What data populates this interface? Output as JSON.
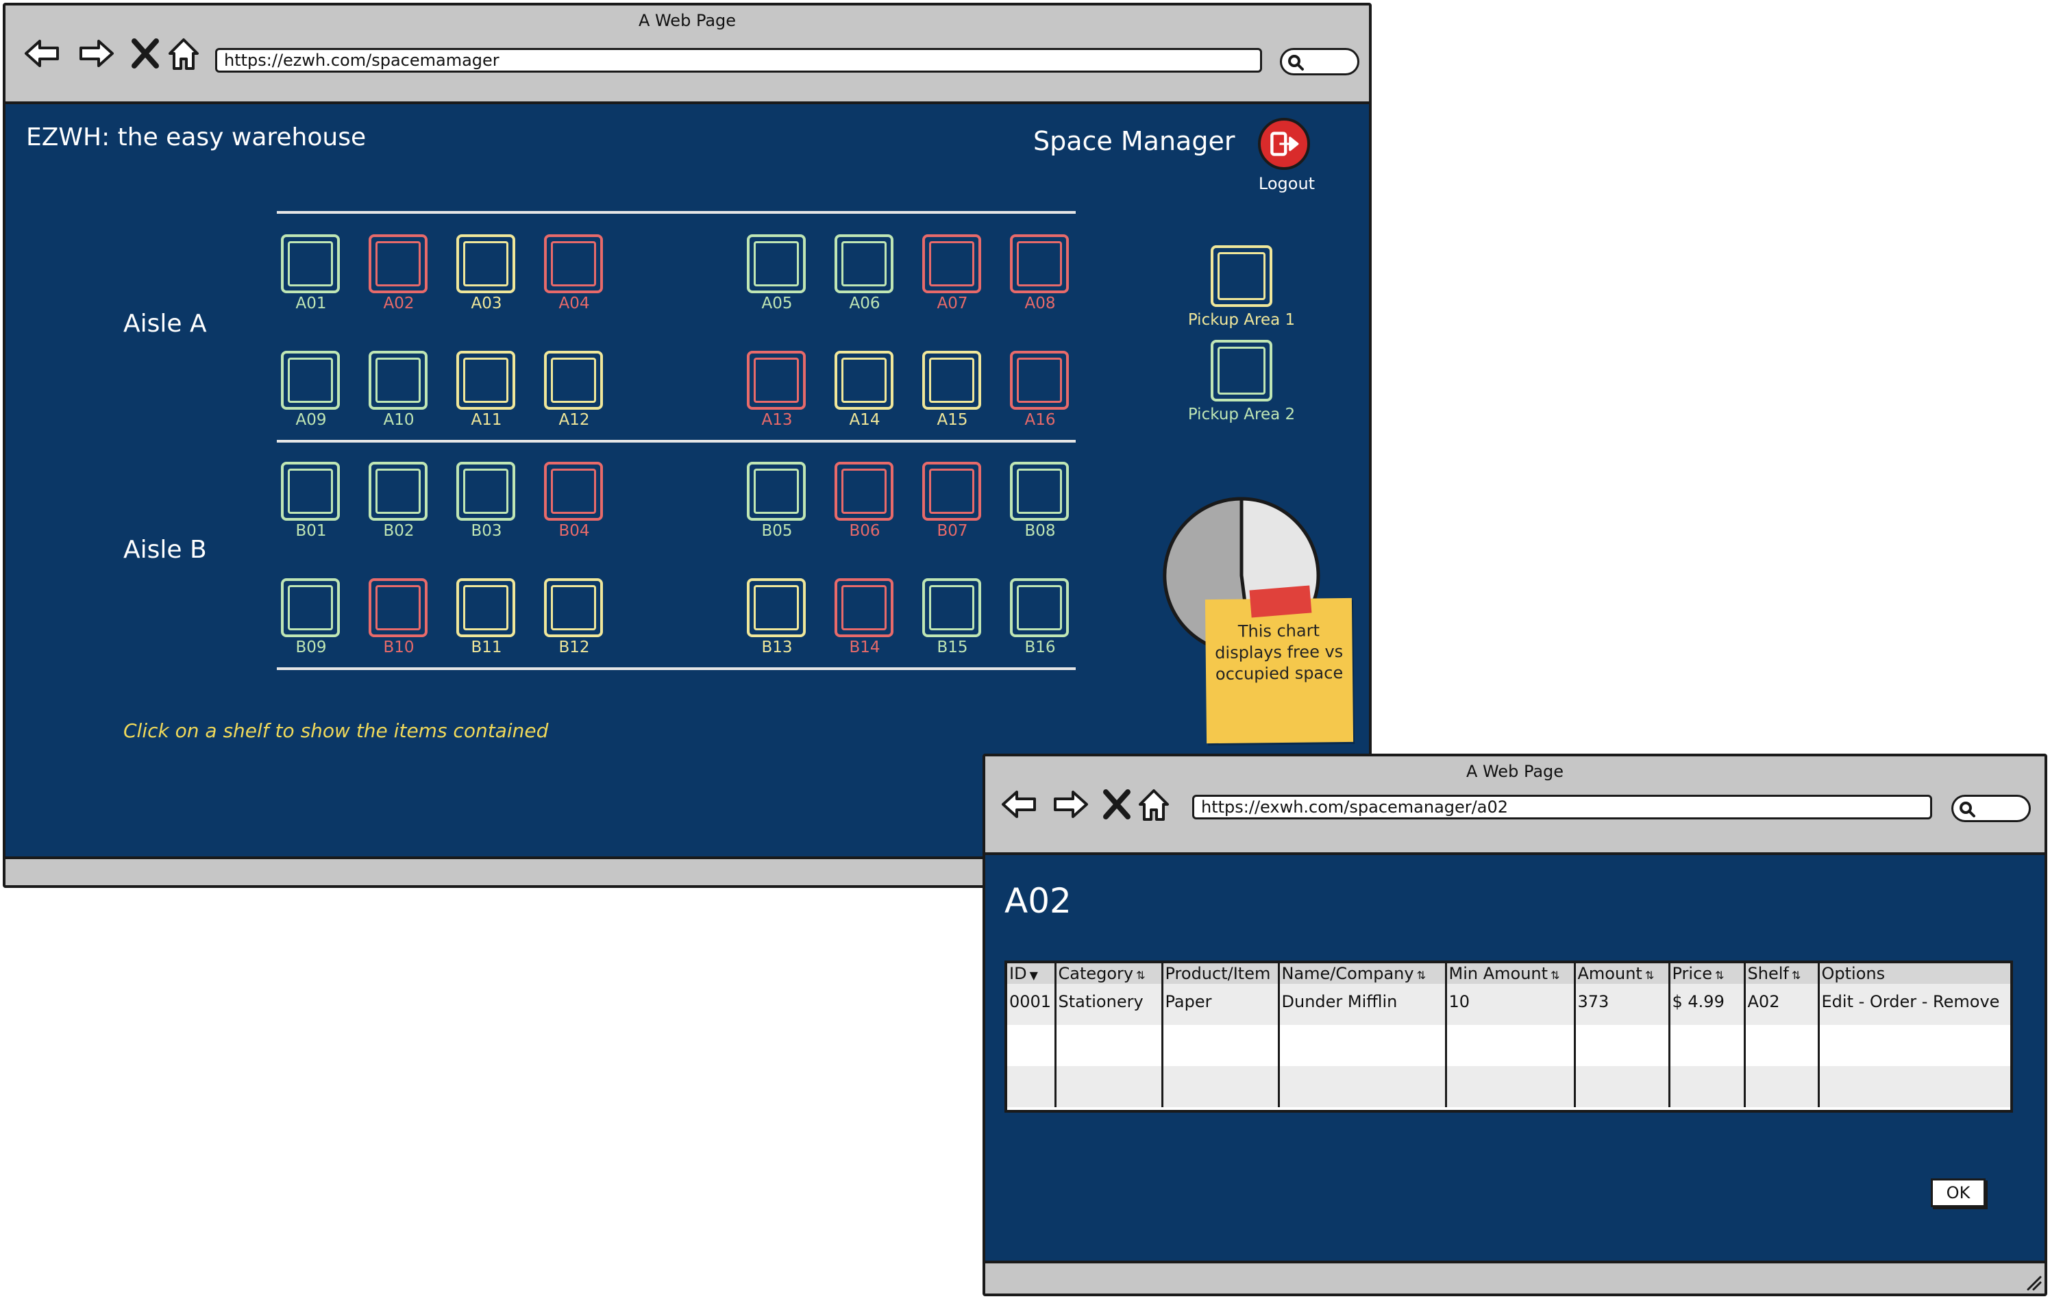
{
  "window1": {
    "title": "A Web Page",
    "url": "https://ezwh.com/spacemamager",
    "app_title": "EZWH: the easy warehouse",
    "page_title": "Space Manager",
    "logout_label": "Logout",
    "aisles": [
      {
        "label": "Aisle A",
        "rows": [
          [
            {
              "id": "A01",
              "status": "free"
            },
            {
              "id": "A02",
              "status": "full"
            },
            {
              "id": "A03",
              "status": "partial"
            },
            {
              "id": "A04",
              "status": "full"
            },
            {
              "id": "A05",
              "status": "free"
            },
            {
              "id": "A06",
              "status": "free"
            },
            {
              "id": "A07",
              "status": "full"
            },
            {
              "id": "A08",
              "status": "full"
            }
          ],
          [
            {
              "id": "A09",
              "status": "free"
            },
            {
              "id": "A10",
              "status": "free"
            },
            {
              "id": "A11",
              "status": "partial"
            },
            {
              "id": "A12",
              "status": "partial"
            },
            {
              "id": "A13",
              "status": "full"
            },
            {
              "id": "A14",
              "status": "partial"
            },
            {
              "id": "A15",
              "status": "partial"
            },
            {
              "id": "A16",
              "status": "full"
            }
          ]
        ]
      },
      {
        "label": "Aisle B",
        "rows": [
          [
            {
              "id": "B01",
              "status": "free"
            },
            {
              "id": "B02",
              "status": "free"
            },
            {
              "id": "B03",
              "status": "free"
            },
            {
              "id": "B04",
              "status": "full"
            },
            {
              "id": "B05",
              "status": "free"
            },
            {
              "id": "B06",
              "status": "full"
            },
            {
              "id": "B07",
              "status": "full"
            },
            {
              "id": "B08",
              "status": "free"
            }
          ],
          [
            {
              "id": "B09",
              "status": "free"
            },
            {
              "id": "B10",
              "status": "full"
            },
            {
              "id": "B11",
              "status": "partial"
            },
            {
              "id": "B12",
              "status": "partial"
            },
            {
              "id": "B13",
              "status": "partial"
            },
            {
              "id": "B14",
              "status": "full"
            },
            {
              "id": "B15",
              "status": "free"
            },
            {
              "id": "B16",
              "status": "free"
            }
          ]
        ]
      }
    ],
    "pickup_areas": [
      {
        "label": "Pickup Area 1",
        "status": "partial"
      },
      {
        "label": "Pickup Area 2",
        "status": "free"
      }
    ],
    "hint": "Click on a shelf to show the items contained",
    "sticky_note": "This chart displays free vs occupied space",
    "space_chart": {
      "free_fraction": 0.48,
      "occupied_fraction": 0.52
    }
  },
  "window2": {
    "title": "A Web Page",
    "url": "https://exwh.com/spacemanager/a02",
    "heading": "A02",
    "columns": [
      "ID",
      "Category",
      "Product/Item",
      "Name/Company",
      "Min Amount",
      "Amount",
      "Price",
      "Shelf",
      "Options"
    ],
    "rows": [
      [
        "0001",
        "Stationery",
        "Paper",
        "Dunder Mifflin",
        "10",
        "373",
        "$ 4.99",
        "A02",
        "Edit - Order - Remove"
      ],
      [
        "",
        "",
        "",
        "",
        "",
        "",
        "",
        "",
        ""
      ],
      [
        "",
        "",
        "",
        "",
        "",
        "",
        "",
        "",
        ""
      ]
    ],
    "ok_label": "OK"
  },
  "colors": {
    "background": "#0b3766",
    "free": "#bfe6b4",
    "partial": "#f0e79a",
    "full": "#e86a6a",
    "chrome": "#c6c6c6",
    "hint": "#f0d95a",
    "logout": "#d92b2b"
  },
  "icons": [
    "back-arrow-icon",
    "forward-arrow-icon",
    "stop-x-icon",
    "home-icon",
    "search-icon",
    "logout-icon",
    "resize-grip-icon"
  ]
}
